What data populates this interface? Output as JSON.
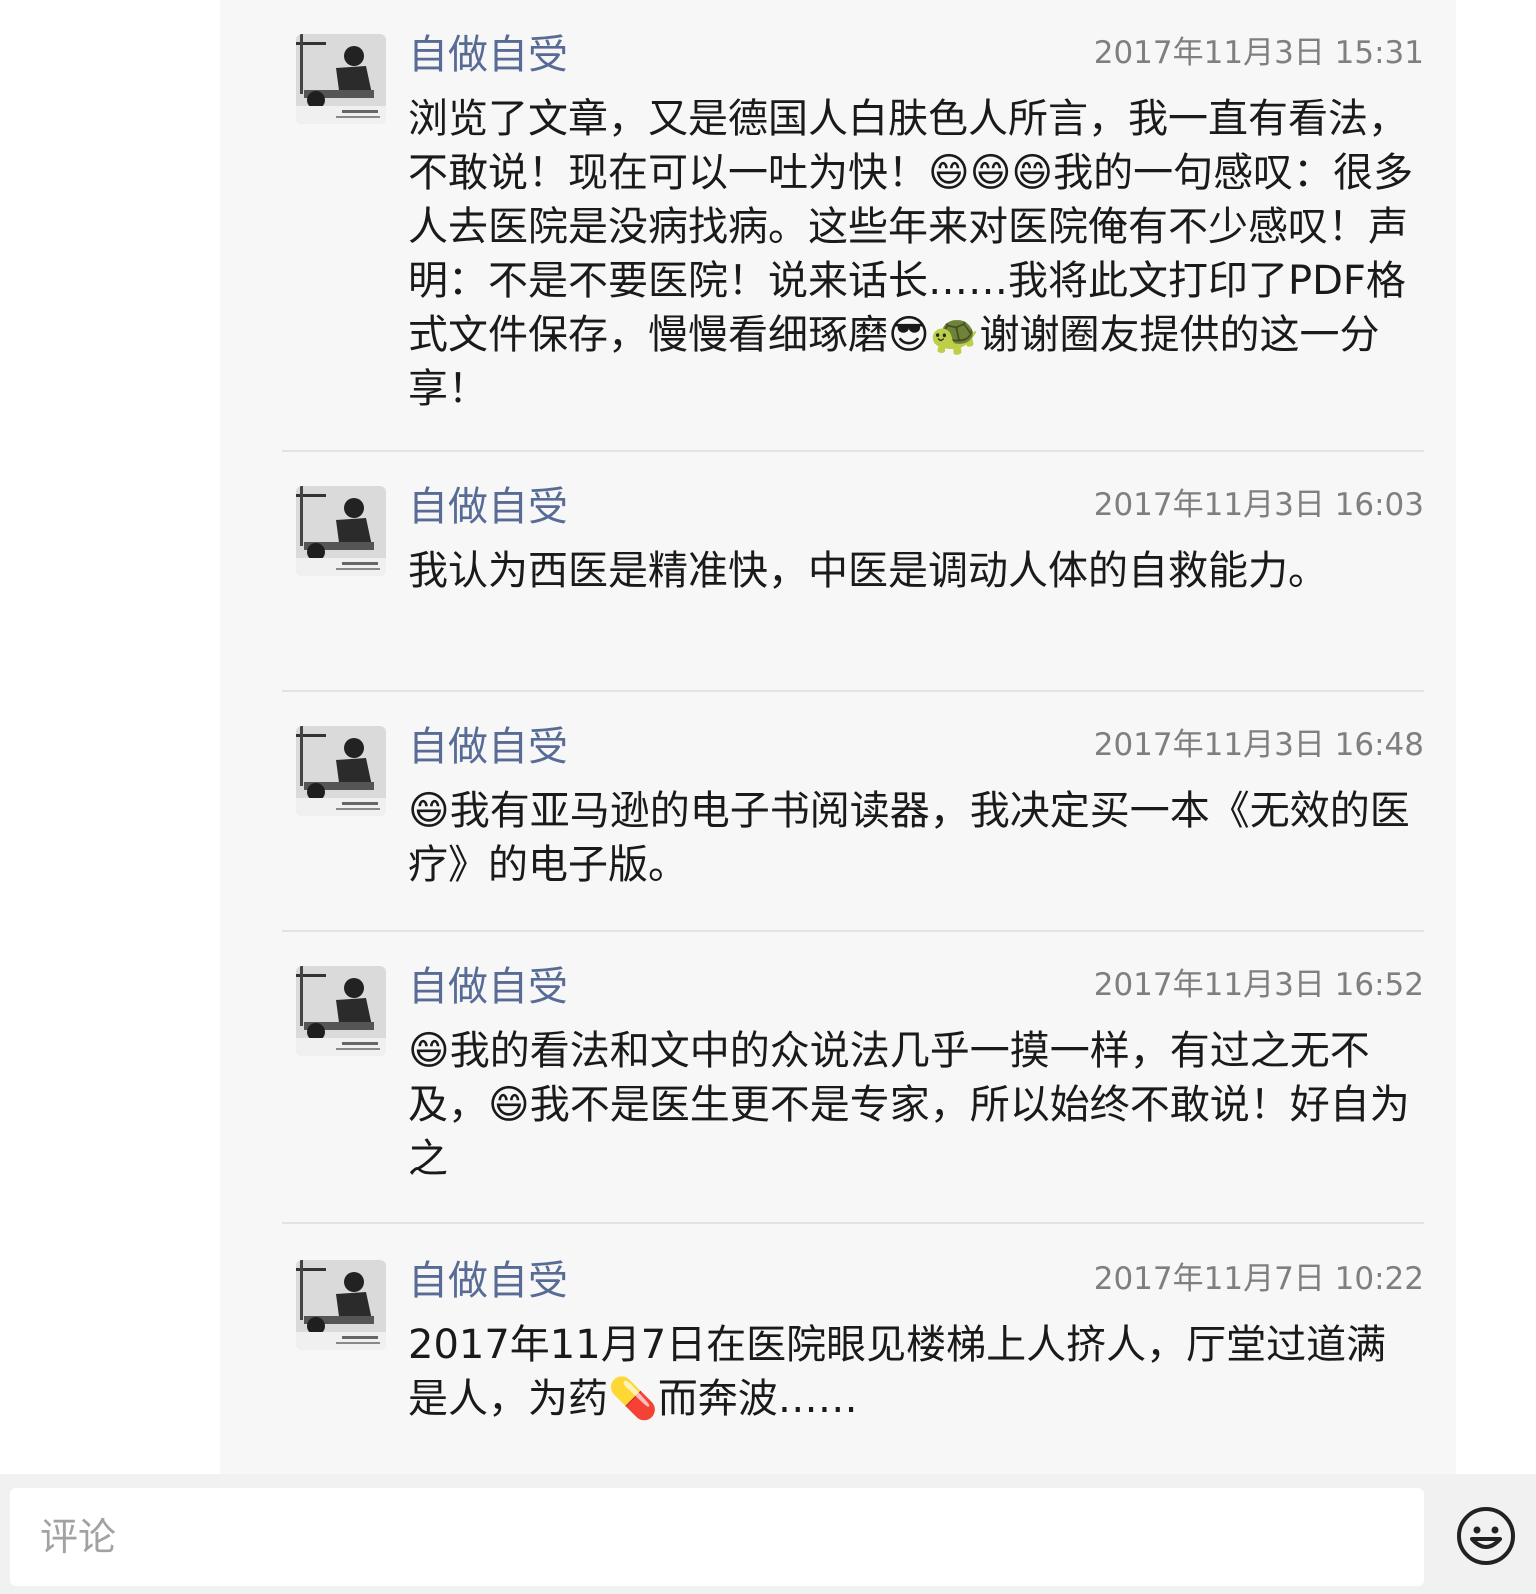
{
  "comments": [
    {
      "author": "自做自受",
      "timestamp": "2017年11月3日 15:31",
      "text": "浏览了文章，又是德国人白肤色人所言，我一直有看法，不敢说！现在可以一吐为快！😄😄😄我的一句感叹：很多人去医院是没病找病。这些年来对医院俺有不少感叹！声明：不是不要医院！说来话长……我将此文打印了PDF格式文件保存，慢慢看细琢磨😎🐢谢谢圈友提供的这一分享！"
    },
    {
      "author": "自做自受",
      "timestamp": "2017年11月3日 16:03",
      "text": "我认为西医是精准快，中医是调动人体的自救能力。"
    },
    {
      "author": "自做自受",
      "timestamp": "2017年11月3日 16:48",
      "text": "😄我有亚马逊的电子书阅读器，我决定买一本《无效的医疗》的电子版。"
    },
    {
      "author": "自做自受",
      "timestamp": "2017年11月3日 16:52",
      "text": "😄我的看法和文中的众说法几乎一摸一样，有过之无不及，😄我不是医生更不是专家，所以始终不敢说！好自为之"
    },
    {
      "author": "自做自受",
      "timestamp": "2017年11月7日 10:22",
      "text": "2017年11月7日在医院眼见楼梯上人挤人，厅堂过道满是人，为药💊而奔波……"
    }
  ],
  "avatar_icon": "user-avatar-photo",
  "comment_bar": {
    "placeholder": "评论",
    "emoji_icon": "smiley-face-icon"
  },
  "colors": {
    "author_name": "#576b95",
    "timestamp": "#7f7f7f",
    "panel_background": "#f7f7f7",
    "divider": "#e3e3e3"
  }
}
